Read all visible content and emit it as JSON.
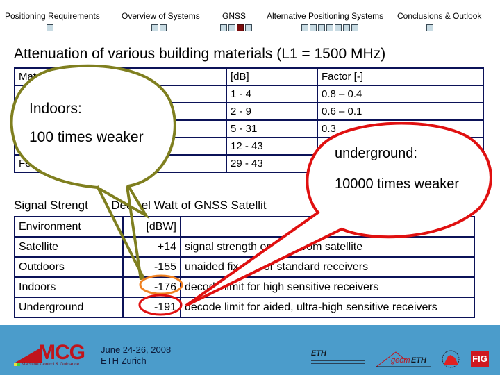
{
  "nav": {
    "items": [
      {
        "label": "Positioning Requirements",
        "dots": 1,
        "active": -1
      },
      {
        "label": "Overview of Systems",
        "dots": 2,
        "active": -1
      },
      {
        "label": "GNSS",
        "dots": 4,
        "active": 2
      },
      {
        "label": "Alternative Positioning Systems",
        "dots": 7,
        "active": -1
      },
      {
        "label": "Conclusions & Outlook",
        "dots": 1,
        "active": -1
      }
    ]
  },
  "title": "Attenuation of various building materials (L1 = 1500 MHz)",
  "attenuation_table": {
    "headers": [
      "Mate",
      "[dB]",
      "Factor [-]"
    ],
    "rows": [
      [
        "",
        "1 - 4",
        "0.8 – 0.4"
      ],
      [
        "",
        "2 - 9",
        "0.6 – 0.1"
      ],
      [
        "",
        "5 - 31",
        "0.3"
      ],
      [
        "",
        "12 - 43",
        ""
      ],
      [
        "Ferro",
        "29 - 43",
        ""
      ]
    ]
  },
  "subtitle": {
    "left": "Signal Strengt",
    "right": "Decibel Watt of GNSS Satellit"
  },
  "signal_table": {
    "headers": [
      "Environment",
      "[dBW]",
      ""
    ],
    "rows": [
      [
        "Satellite",
        "+14",
        "signal strength emitted from satellite"
      ],
      [
        "Outdoors",
        "-155",
        "unaided fix OK for standard receivers"
      ],
      [
        "Indoors",
        "-176",
        "decode limit for high sensitive receivers"
      ],
      [
        "Underground",
        "-191",
        "decode limit for aided, ultra-high sensitive receivers"
      ]
    ]
  },
  "callouts": {
    "indoors": {
      "line1": "Indoors:",
      "line2": "100 times weaker",
      "color": "#7f7f1f"
    },
    "underground": {
      "line1": "underground:",
      "line2": "10000 times weaker",
      "color": "#e01010"
    },
    "highlight_indoor_color": "#f08020",
    "highlight_underground_color": "#e01010"
  },
  "footer": {
    "background": "#4b9ccb",
    "logo_mcg": "MCG",
    "logo_mcg_sub": "Machine Control & Guidance",
    "date": "June 24-26, 2008",
    "location": "ETH Zurich",
    "logo_eth": "ETH",
    "logo_geometh_a": "geom",
    "logo_geometh_b": "ETH",
    "logo_fig": "FIG"
  }
}
